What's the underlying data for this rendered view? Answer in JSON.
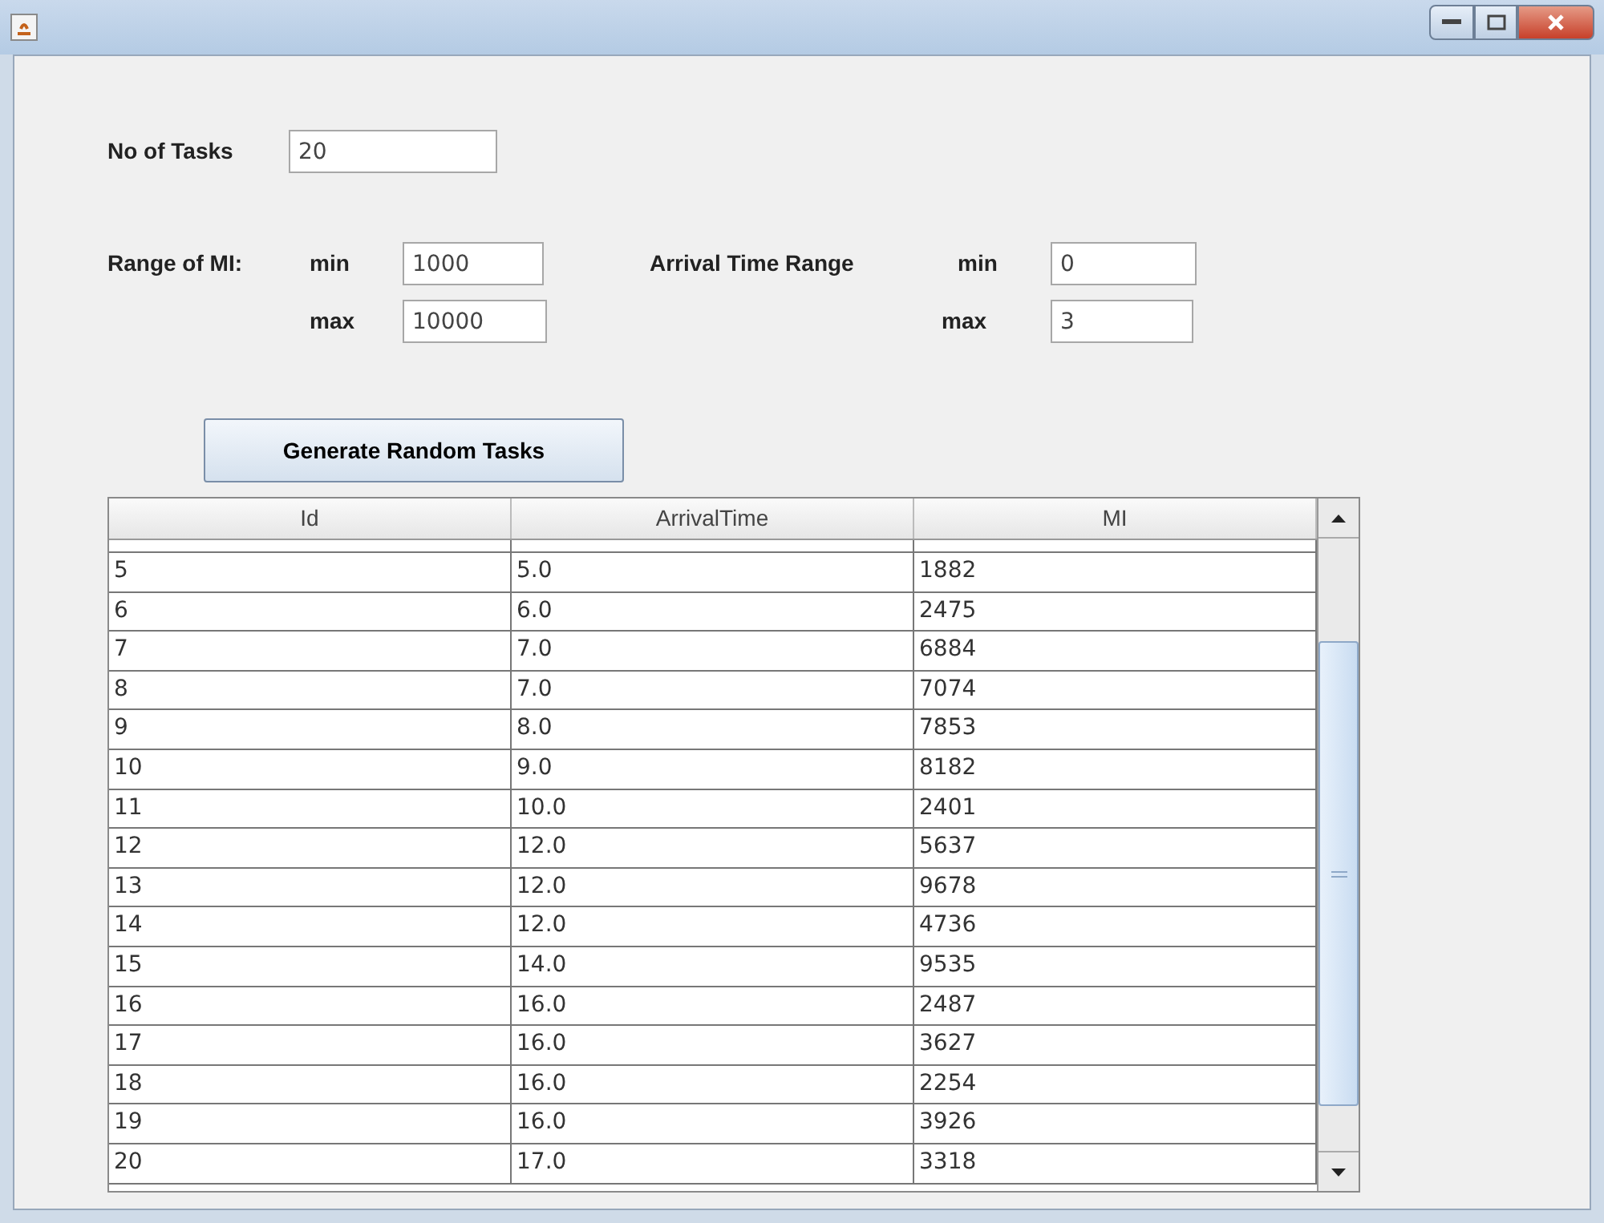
{
  "form": {
    "tasks": {
      "label": "No of Tasks",
      "value": "20"
    },
    "mi_range": {
      "label": "Range of MI:",
      "min_label": "min",
      "min": "1000",
      "max_label": "max",
      "max": "10000"
    },
    "arrival_range": {
      "label": "Arrival Time Range",
      "min_label": "min",
      "min": "0",
      "max_label": "max",
      "max": "3"
    }
  },
  "button": {
    "label": "Generate Random Tasks"
  },
  "table": {
    "columns": [
      "Id",
      "ArrivalTime",
      "MI"
    ],
    "rows": [
      {
        "id": "5",
        "arrival_time": "5.0",
        "mi": "1882"
      },
      {
        "id": "6",
        "arrival_time": "6.0",
        "mi": "2475"
      },
      {
        "id": "7",
        "arrival_time": "7.0",
        "mi": "6884"
      },
      {
        "id": "8",
        "arrival_time": "7.0",
        "mi": "7074"
      },
      {
        "id": "9",
        "arrival_time": "8.0",
        "mi": "7853"
      },
      {
        "id": "10",
        "arrival_time": "9.0",
        "mi": "8182"
      },
      {
        "id": "11",
        "arrival_time": "10.0",
        "mi": "2401"
      },
      {
        "id": "12",
        "arrival_time": "12.0",
        "mi": "5637"
      },
      {
        "id": "13",
        "arrival_time": "12.0",
        "mi": "9678"
      },
      {
        "id": "14",
        "arrival_time": "12.0",
        "mi": "4736"
      },
      {
        "id": "15",
        "arrival_time": "14.0",
        "mi": "9535"
      },
      {
        "id": "16",
        "arrival_time": "16.0",
        "mi": "2487"
      },
      {
        "id": "17",
        "arrival_time": "16.0",
        "mi": "3627"
      },
      {
        "id": "18",
        "arrival_time": "16.0",
        "mi": "2254"
      },
      {
        "id": "19",
        "arrival_time": "16.0",
        "mi": "3926"
      },
      {
        "id": "20",
        "arrival_time": "17.0",
        "mi": "3318"
      }
    ]
  }
}
